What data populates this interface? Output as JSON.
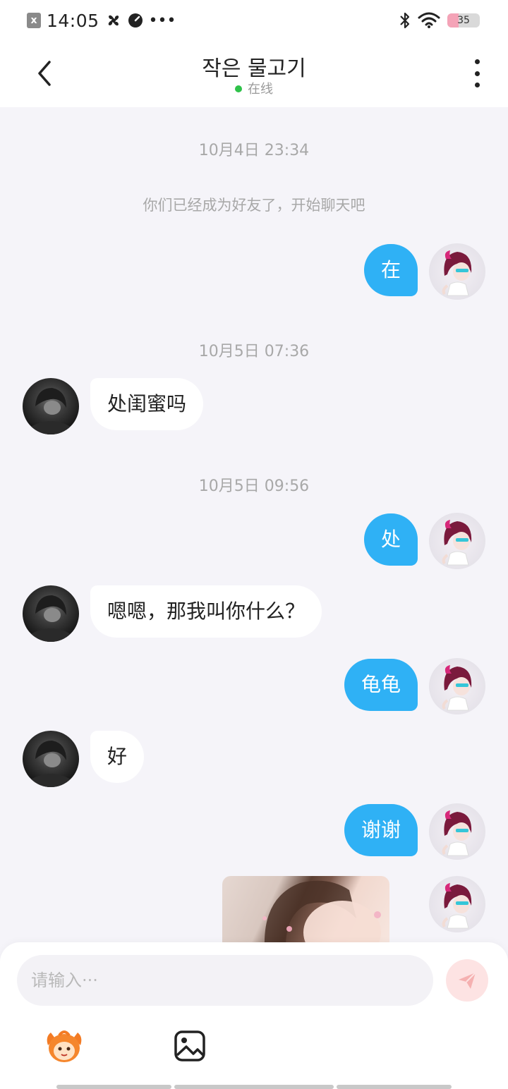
{
  "status_bar": {
    "time": "14:05",
    "extra_glyphs": "•••",
    "battery": "35",
    "battery_level": 0.35
  },
  "header": {
    "title": "작은 물고기",
    "status": "在线",
    "online_color": "#2fc24a"
  },
  "chat": {
    "timestamps": [
      "10月4日 23:34",
      "10月5日 07:36",
      "10月5日 09:56"
    ],
    "system_note": "你们已经成为好友了，开始聊天吧",
    "messages": [
      {
        "side": "out",
        "text": "在"
      },
      {
        "side": "in",
        "text": "处闺蜜吗"
      },
      {
        "side": "out",
        "text": "处"
      },
      {
        "side": "in",
        "text": "嗯嗯，那我叫你什么？"
      },
      {
        "side": "out",
        "text": "龟龟"
      },
      {
        "side": "in",
        "text": "好"
      },
      {
        "side": "out",
        "text": "谢谢"
      }
    ],
    "outgoing_color": "#2fb1f5"
  },
  "composer": {
    "placeholder": "请输入···",
    "icons": [
      "send-icon",
      "emoji-icon",
      "image-icon"
    ]
  }
}
